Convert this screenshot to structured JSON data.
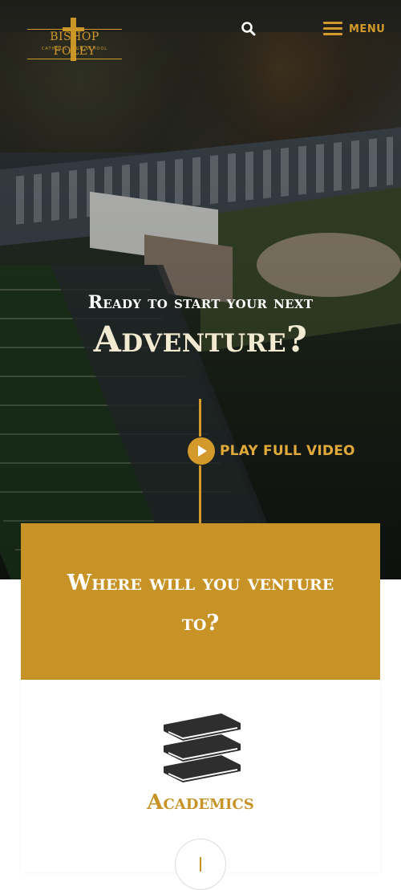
{
  "header": {
    "logo_name": "BISHOP FOLEY",
    "logo_sub": "CATHOLIC HIGH SCHOOL",
    "search_icon": "search-icon",
    "menu_icon": "hamburger-icon",
    "menu_label": "MENU"
  },
  "hero": {
    "line1": "Ready to start your next",
    "line2": "Adventure?",
    "play_icon": "play-icon",
    "play_label": "PLAY FULL VIDEO"
  },
  "card": {
    "title": "Where will you venture to?",
    "item_icon": "books-icon",
    "item_label": "Academics",
    "expand_icon": "plus-icon"
  },
  "colors": {
    "accent": "#c89326",
    "accent_text": "#d39a2b",
    "hero_title": "#f3ead2"
  }
}
